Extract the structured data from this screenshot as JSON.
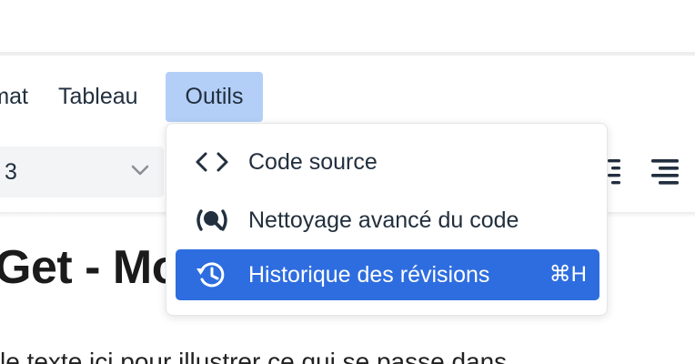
{
  "menubar": {
    "items": [
      {
        "label": "rmat"
      },
      {
        "label": "Tableau"
      },
      {
        "label": "Outils"
      }
    ],
    "active": "Outils"
  },
  "toolbar": {
    "block_format_value": "3",
    "icons": [
      "chevron-down-icon",
      "align-justify-icon",
      "align-right-icon"
    ]
  },
  "content": {
    "heading": "Get - Mo",
    "paragraph": "le texte ici pour illustrer ce qui se passe dans"
  },
  "dropdown": {
    "items": [
      {
        "label": "Code source",
        "icon": "code-icon",
        "shortcut": ""
      },
      {
        "label": "Nettoyage avancé du code",
        "icon": "search-code-icon",
        "shortcut": ""
      },
      {
        "label": "Historique des révisions",
        "icon": "history-icon",
        "shortcut": "⌘H"
      }
    ],
    "highlighted_index": 2
  },
  "colors": {
    "menu_active_bg": "#b3cff7",
    "item_highlight_bg": "#2e6de0",
    "text": "#222f3e"
  }
}
